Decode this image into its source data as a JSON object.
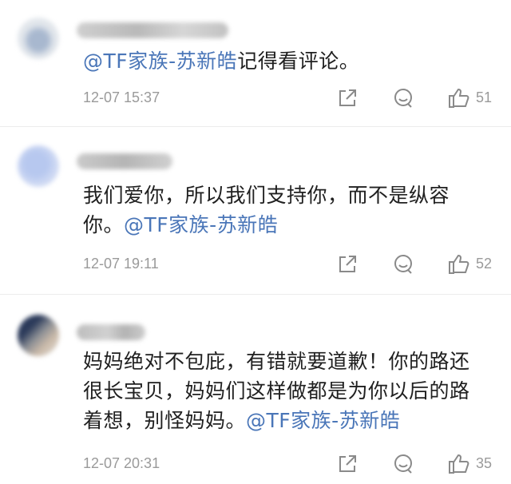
{
  "comments": [
    {
      "body_parts": [
        {
          "text": "@TF家族-苏新皓",
          "mention": true
        },
        {
          "text": "记得看评论。",
          "mention": false
        }
      ],
      "time": "12-07 15:37",
      "likes": "51"
    },
    {
      "body_parts": [
        {
          "text": "我们爱你，所以我们支持你，而不是纵容你。",
          "mention": false
        },
        {
          "text": "@TF家族-苏新皓",
          "mention": true
        }
      ],
      "time": "12-07 19:11",
      "likes": "52"
    },
    {
      "body_parts": [
        {
          "text": "妈妈绝对不包庇，有错就要道歉！你的路还很长宝贝，妈妈们这样做都是为你以后的路着想，别怪妈妈。",
          "mention": false
        },
        {
          "text": "@TF家族-苏新皓",
          "mention": true
        }
      ],
      "time": "12-07 20:31",
      "likes": "35"
    }
  ],
  "colors": {
    "mention": "#4a76b8",
    "meta_text": "#9a9a9a",
    "body_text": "#202020"
  },
  "icons": [
    "share-icon",
    "comment-icon",
    "like-icon"
  ]
}
